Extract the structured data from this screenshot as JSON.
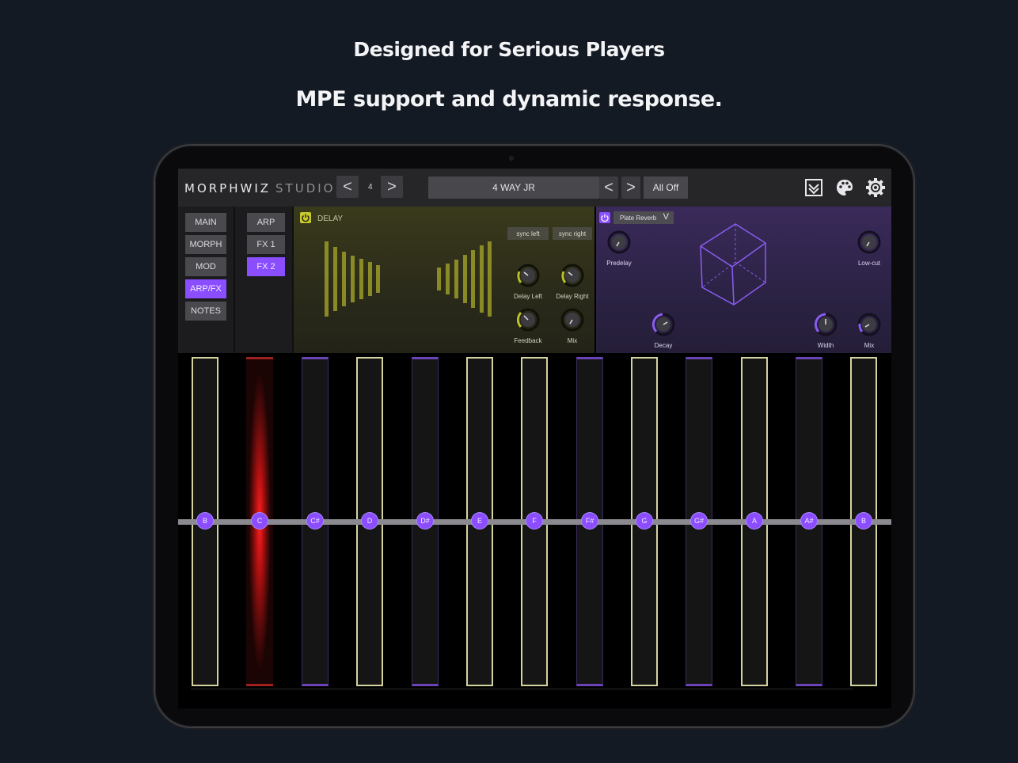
{
  "marketing": {
    "headline": "Designed for Serious Players",
    "subheadline": "MPE support and dynamic response."
  },
  "app": {
    "logo_main": "MORPHWIZ",
    "logo_sub": "STUDIO",
    "octave_prev": "<",
    "octave_value": "4",
    "octave_next": ">",
    "preset_name": "4 WAY JR",
    "preset_prev": "<",
    "preset_next": ">",
    "all_off": "All Off",
    "icons": [
      "save-icon",
      "palette-icon",
      "gear-icon"
    ]
  },
  "menu": {
    "col1": [
      "MAIN",
      "MORPH",
      "MOD",
      "ARP/FX",
      "NOTES"
    ],
    "col2": [
      "ARP",
      "FX 1",
      "FX 2"
    ],
    "active_col1": "ARP/FX",
    "active_col2": "FX 2"
  },
  "delay": {
    "title": "DELAY",
    "sync_left": "sync left",
    "sync_right": "sync right",
    "knobs": [
      "Delay Left",
      "Delay Right",
      "Feedback",
      "Mix"
    ]
  },
  "reverb": {
    "type": "Plate Reverb",
    "dropdown_arrow": "V",
    "knobs": [
      "Predelay",
      "Low-cut",
      "Decay",
      "Width",
      "Mix"
    ]
  },
  "keyboard": {
    "notes": [
      "B",
      "C",
      "C#",
      "D",
      "D#",
      "E",
      "F",
      "F#",
      "G",
      "G#",
      "A",
      "A#",
      "B"
    ],
    "active_note": "C"
  },
  "colors": {
    "accent": "#8a4dff",
    "delay_accent": "#c8c830",
    "key_active": "#ff2020"
  }
}
